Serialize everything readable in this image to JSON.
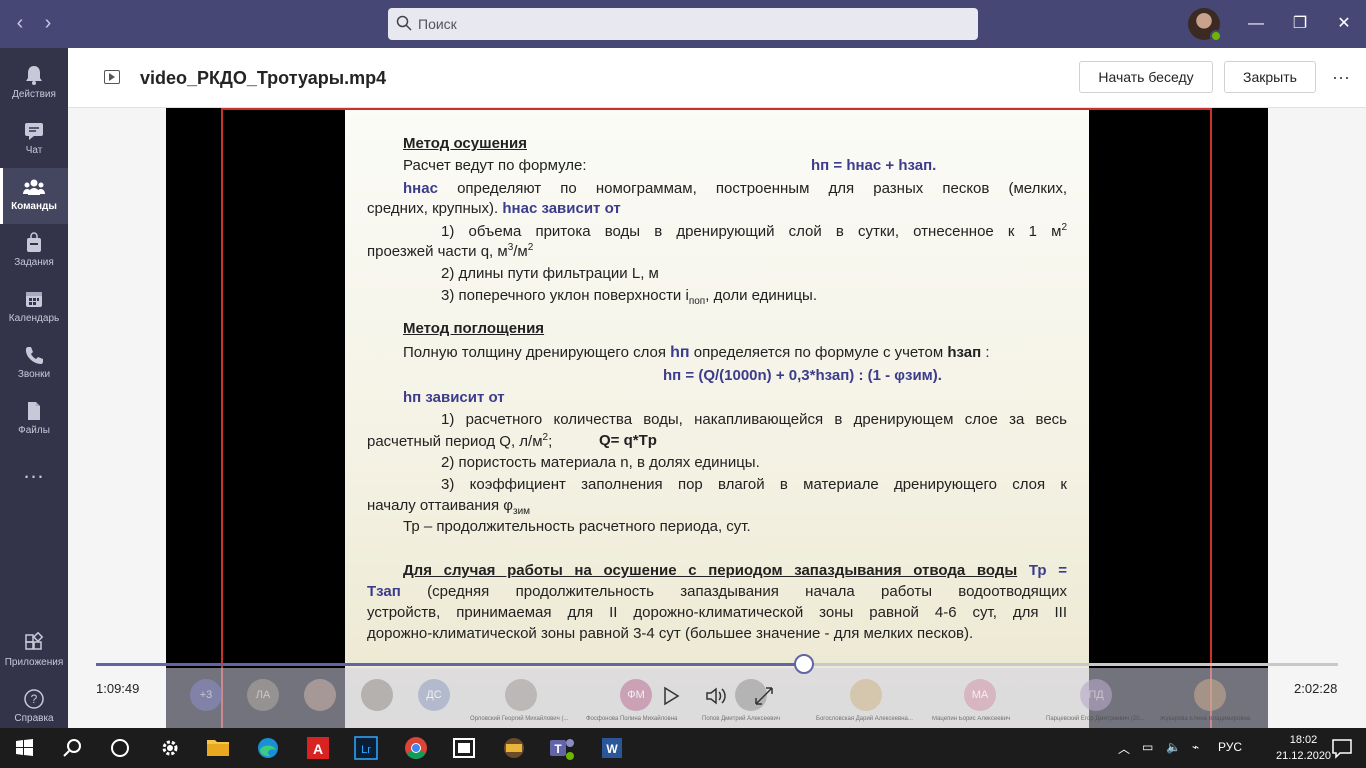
{
  "titlebar": {
    "search_placeholder": "Поиск",
    "back": "‹",
    "forward": "›",
    "minimize": "—",
    "maximize": "❐",
    "close": "✕"
  },
  "rail": [
    {
      "label": "Действия",
      "icon": "bell-icon"
    },
    {
      "label": "Чат",
      "icon": "chat-icon"
    },
    {
      "label": "Команды",
      "icon": "teams-icon",
      "active": true
    },
    {
      "label": "Задания",
      "icon": "assignments-icon"
    },
    {
      "label": "Календарь",
      "icon": "calendar-icon"
    },
    {
      "label": "Звонки",
      "icon": "phone-icon"
    },
    {
      "label": "Файлы",
      "icon": "files-icon"
    },
    {
      "label": "…",
      "icon": "more-icon"
    },
    {
      "label": "Приложения",
      "icon": "apps-icon"
    },
    {
      "label": "Справка",
      "icon": "help-icon"
    }
  ],
  "header": {
    "title": "video_РКДО_Тротуары.mp4",
    "start_chat": "Начать беседу",
    "close": "Закрыть",
    "more": "···"
  },
  "slide": {
    "h1": "Метод осушения",
    "l1": "Расчет ведут по формуле:",
    "f1": "hп = hнас + hзап.",
    "l2a": "hнас",
    "l2b": "определяют по номограммам, построенным для разных песков (мелких,",
    "l3a": "средних, крупных).",
    "l3b": "hнас зависит от",
    "l4": "1) объема притока воды в дренирующий слой в сутки, отнесенное к 1 м",
    "l4sup": "2",
    "l5": "проезжей части q, м",
    "l5sup": "3",
    "l5b": "/м",
    "l5sup2": "2",
    "l6": "2) длины пути фильтрации L, м",
    "l7": "3) поперечного уклон поверхности i",
    "l7sub": "поп",
    "l7b": ", доли единицы.",
    "h2": "Метод поглощения",
    "l8a": "Полную толщину дренирующего слоя",
    "l8b": "hп",
    "l8c": "определяется по формуле с учетом",
    "l8d": "hзап",
    "l8e": ":",
    "f2": "hп = (Q/(1000n) + 0,3*hзап) : (1 - φзим).",
    "l9": "hп зависит от",
    "l10": "1) расчетного количества воды, накапливающейся в дренирующем слое за весь",
    "l11": "расчетный период Q, л/м",
    "l11sup": "2",
    "l11b": ";",
    "l11c": "Q= q*Tр",
    "l12": "2) пористость материала n, в долях единицы.",
    "l13": "3) коэффициент заполнения пор влагой в материале дренирующего слоя к",
    "l14": "началу оттаивания φ",
    "l14sub": "зим",
    "l15": "Тр – продолжительность расчетного периода, сут.",
    "l16a": "Для случая работы на осушение с периодом запаздывания отвода воды",
    "l16b": "Тр =",
    "l17a": "Тзап",
    "l17b": "(средняя продолжительность запаздывания начала работы водоотводящих",
    "l18": "устройств, принимаемая для II дорожно-климатической зоны равной 4-6 сут, для III",
    "l19": "дорожно-климатической зоны равной 3-4 сут (большее значение - для мелких песков)."
  },
  "player": {
    "current_time": "1:09:49",
    "total_time": "2:02:28",
    "progress": 0.57,
    "participants": [
      {
        "initials": "+3",
        "color": "#8a8cc4"
      },
      {
        "initials": "ЛА",
        "color": "#b0a8a0"
      },
      {
        "initials": "",
        "color": "#c8b0a8"
      },
      {
        "initials": "",
        "color": "#9a9490"
      },
      {
        "initials": "ДС",
        "color": "#9aa4c4"
      },
      {
        "initials": "",
        "color": "#a8a0a0",
        "name": "Орловский Георгий Михайлович (..."
      },
      {
        "initials": "ФМ",
        "color": "#c07c9c",
        "name": "Фосфонова Полина Михайловна"
      },
      {
        "initials": "",
        "color": "#9a9a9a",
        "name": "Попов Дмитрий Алексеевич"
      },
      {
        "initials": "",
        "color": "#d0b890",
        "name": "Богословская Дарий Алексеевна..."
      },
      {
        "initials": "МА",
        "color": "#d49cb0",
        "name": "Мацепин Борис Алексеевич"
      },
      {
        "initials": "ПД",
        "color": "#b8a8c8",
        "name": "Парцевский Егор Дмитриевич (20..."
      },
      {
        "initials": "",
        "color": "#c8a890",
        "name": "Жукарова Елена Владимировна"
      }
    ]
  },
  "taskbar": {
    "lang": "РУС",
    "time": "18:02",
    "date": "21.12.2020",
    "apps": [
      "start",
      "search",
      "cortana",
      "settings",
      "explorer",
      "edge",
      "acrobat",
      "lightroom",
      "chrome",
      "media-player",
      "archiver",
      "teams",
      "word"
    ]
  }
}
